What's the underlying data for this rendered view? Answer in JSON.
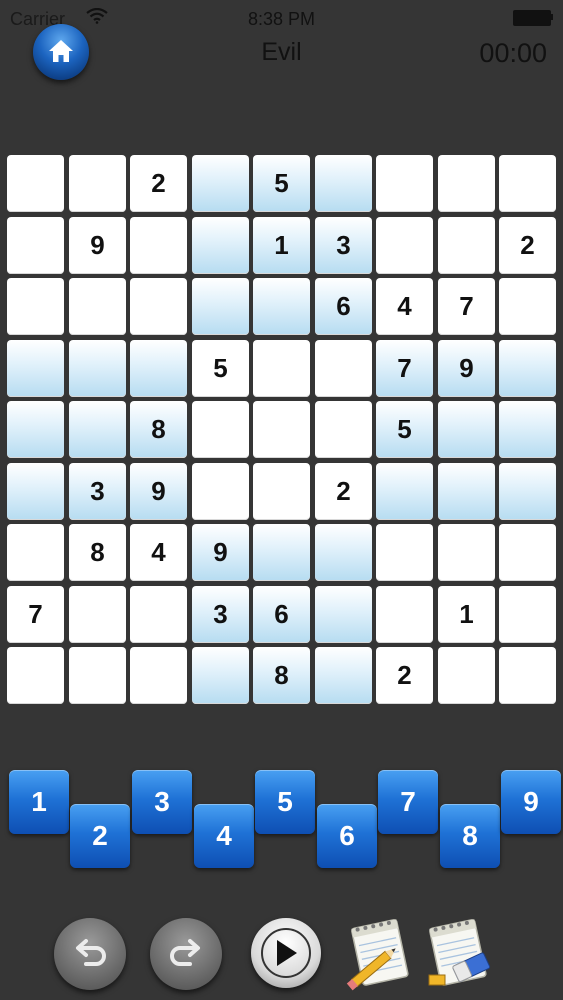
{
  "status_bar": {
    "carrier": "Carrier",
    "time": "8:38 PM"
  },
  "header": {
    "title": "Evil",
    "timer": "00:00"
  },
  "grid": {
    "cells": [
      [
        "",
        "",
        "2",
        "",
        "5",
        "",
        "",
        "",
        ""
      ],
      [
        "",
        "9",
        "",
        "",
        "1",
        "3",
        "",
        "",
        "2"
      ],
      [
        "",
        "",
        "",
        "",
        "",
        "6",
        "4",
        "7",
        ""
      ],
      [
        "",
        "",
        "",
        "5",
        "",
        "",
        "7",
        "9",
        ""
      ],
      [
        "",
        "",
        "8",
        "",
        "",
        "",
        "5",
        "",
        ""
      ],
      [
        "",
        "3",
        "9",
        "",
        "",
        "2",
        "",
        "",
        ""
      ],
      [
        "",
        "8",
        "4",
        "9",
        "",
        "",
        "",
        "",
        ""
      ],
      [
        "7",
        "",
        "",
        "3",
        "6",
        "",
        "",
        "1",
        ""
      ],
      [
        "",
        "",
        "",
        "",
        "8",
        "",
        "2",
        "",
        ""
      ]
    ]
  },
  "number_pad": {
    "keys": [
      "1",
      "2",
      "3",
      "4",
      "5",
      "6",
      "7",
      "8",
      "9"
    ]
  },
  "toolbar": {
    "icons": [
      "undo-icon",
      "redo-icon",
      "play-icon",
      "notepad-pencil-icon",
      "notepad-eraser-icon"
    ]
  }
}
